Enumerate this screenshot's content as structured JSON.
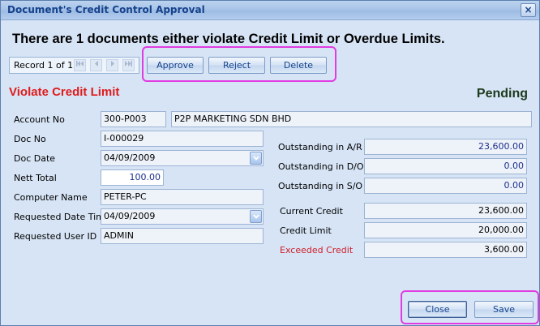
{
  "window": {
    "title": "Document's Credit Control Approval",
    "close_glyph": "×"
  },
  "heading": "There are 1 documents either violate Credit Limit or Overdue Limits.",
  "navigator": {
    "record_text": "Record 1 of 1",
    "icons": [
      "first-icon",
      "prev-icon",
      "next-icon",
      "last-icon"
    ]
  },
  "toolbar": {
    "approve": "Approve",
    "reject": "Reject",
    "delete": "Delete"
  },
  "status": {
    "violation": "Violate Credit Limit",
    "state": "Pending"
  },
  "left_form": {
    "account_no": {
      "label": "Account No",
      "code": "300-P003",
      "name": "P2P MARKETING SDN BHD"
    },
    "doc_no": {
      "label": "Doc No",
      "value": "I-000029"
    },
    "doc_date": {
      "label": "Doc Date",
      "value": "04/09/2009"
    },
    "nett_total": {
      "label": "Nett Total",
      "value": "100.00"
    },
    "computer_name": {
      "label": "Computer Name",
      "value": "PETER-PC"
    },
    "requested_date_time": {
      "label": "Requested Date Time",
      "value": "04/09/2009"
    },
    "requested_user_id": {
      "label": "Requested User ID",
      "value": "ADMIN"
    }
  },
  "right_form": {
    "outstanding_ar": {
      "label": "Outstanding in A/R",
      "value": "23,600.00"
    },
    "outstanding_do": {
      "label": "Outstanding in D/O",
      "value": "0.00"
    },
    "outstanding_so": {
      "label": "Outstanding in S/O",
      "value": "0.00"
    },
    "current_credit": {
      "label": "Current Credit",
      "value": "23,600.00"
    },
    "credit_limit": {
      "label": "Credit Limit",
      "value": "20,000.00"
    },
    "exceeded_credit": {
      "label": "Exceeded Credit",
      "value": "3,600.00"
    }
  },
  "footer": {
    "close": "Close",
    "save": "Save"
  },
  "colors": {
    "violation_red": "#e01b1b",
    "highlight": "#e13ce1",
    "title_blue": "#15428b"
  }
}
